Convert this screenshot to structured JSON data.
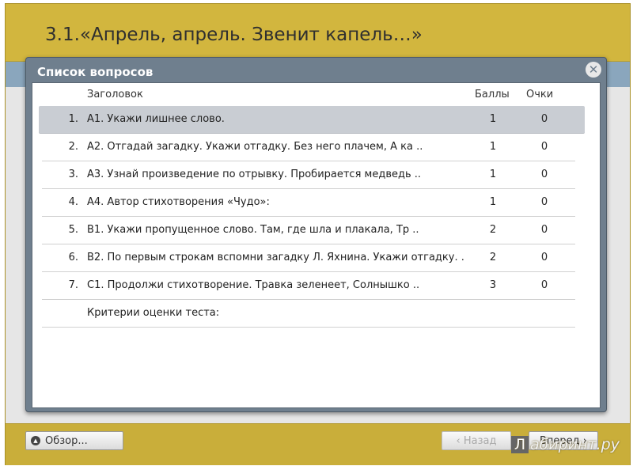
{
  "page": {
    "title": "3.1.«Апрель, апрель. Звенит капель…»"
  },
  "dialog": {
    "title": "Список вопросов",
    "close_glyph": "✕",
    "headers": {
      "title": "Заголовок",
      "points": "Баллы",
      "glasses": "Очки"
    },
    "rows": [
      {
        "num": "1.",
        "text": "А1. Укажи лишнее слово.",
        "points": "1",
        "glasses": "0",
        "selected": true
      },
      {
        "num": "2.",
        "text": "А2. Отгадай загадку. Укажи отгадку.       Без него плачем,        А ка ..",
        "points": "1",
        "glasses": "0"
      },
      {
        "num": "3.",
        "text": "А3. Узнай произведение по отрывку.      Пробирается медведь          ..",
        "points": "1",
        "glasses": "0"
      },
      {
        "num": "4.",
        "text": "А4. Автор стихотворения «Чудо»:",
        "points": "1",
        "glasses": "0"
      },
      {
        "num": "5.",
        "text": "В1. Укажи пропущенное слово.       Там, где шла и плакала,        Тр ..",
        "points": "2",
        "glasses": "0"
      },
      {
        "num": "6.",
        "text": "В2. По первым строкам вспомни загадку Л. Яхнина. Укажи отгадку.   .",
        "points": "2",
        "glasses": "0"
      },
      {
        "num": "7.",
        "text": "С1. Продолжи стихотворение.       Травка зеленеет,       Солнышко  ..",
        "points": "3",
        "glasses": "0"
      },
      {
        "num": "",
        "text": "Критерии оценки теста:",
        "points": "",
        "glasses": ""
      }
    ]
  },
  "footer": {
    "overview_label": "Обзор...",
    "back_label": "‹ Назад",
    "next_label": "Вперед ›"
  },
  "watermark": {
    "box": "Л",
    "text": "абиринт.ру"
  }
}
